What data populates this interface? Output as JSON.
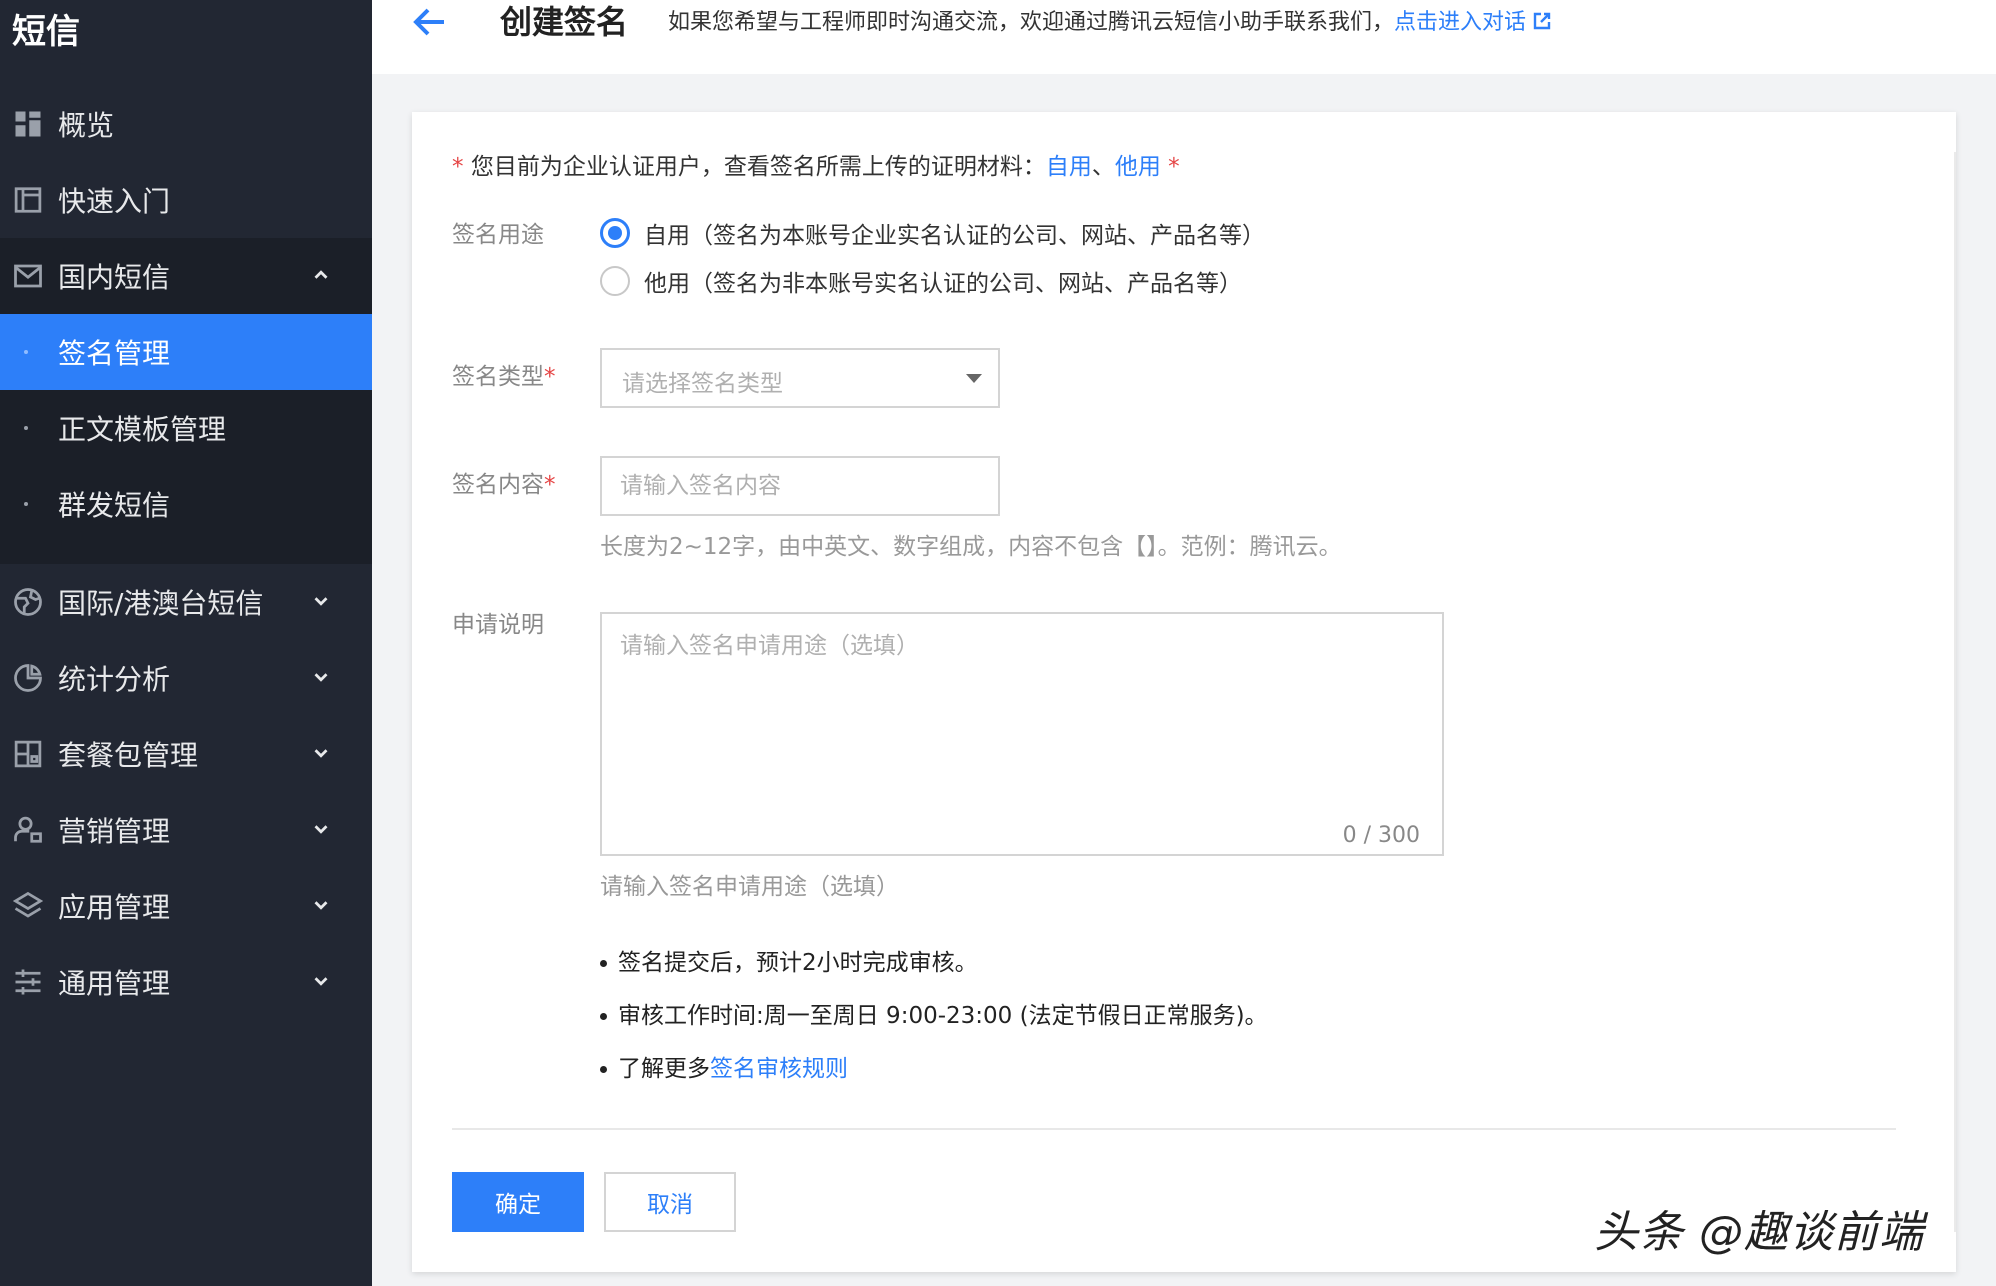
{
  "sidebar": {
    "title": "短信",
    "items": [
      {
        "label": "概览",
        "icon": "dashboard-icon"
      },
      {
        "label": "快速入门",
        "icon": "book-icon"
      },
      {
        "label": "国内短信",
        "icon": "mail-icon",
        "expanded": true,
        "children": [
          {
            "label": "签名管理",
            "active": true
          },
          {
            "label": "正文模板管理"
          },
          {
            "label": "群发短信"
          }
        ]
      },
      {
        "label": "国际/港澳台短信",
        "icon": "globe-icon"
      },
      {
        "label": "统计分析",
        "icon": "pie-chart-icon"
      },
      {
        "label": "套餐包管理",
        "icon": "package-icon"
      },
      {
        "label": "营销管理",
        "icon": "users-icon"
      },
      {
        "label": "应用管理",
        "icon": "layers-icon"
      },
      {
        "label": "通用管理",
        "icon": "sliders-icon"
      }
    ]
  },
  "header": {
    "title": "创建签名",
    "notice_text": "如果您希望与工程师即时沟通交流，欢迎通过腾讯云短信小助手联系我们，",
    "notice_link": "点击进入对话"
  },
  "form": {
    "hint_text": "您目前为企业认证用户，查看签名所需上传的证明材料：",
    "hint_link_self": "自用",
    "hint_sep": "、",
    "hint_link_other": "他用",
    "purpose": {
      "label": "签名用途",
      "options": [
        {
          "label": "自用（签名为本账号企业实名认证的公司、网站、产品名等）",
          "selected": true
        },
        {
          "label": "他用（签名为非本账号实名认证的公司、网站、产品名等）",
          "selected": false
        }
      ]
    },
    "type": {
      "label": "签名类型",
      "placeholder": "请选择签名类型"
    },
    "content": {
      "label": "签名内容",
      "placeholder": "请输入签名内容",
      "help": "长度为2~12字，由中英文、数字组成，内容不包含【】。范例：腾讯云。"
    },
    "description": {
      "label": "申请说明",
      "placeholder": "请输入签名申请用途（选填）",
      "counter": "0 / 300",
      "help": "请输入签名申请用途（选填）"
    },
    "notes": [
      "签名提交后，预计2小时完成审核。",
      "审核工作时间:周一至周日 9:00-23:00 (法定节假日正常服务)。"
    ],
    "note_more_prefix": "了解更多",
    "note_more_link": "签名审核规则",
    "buttons": {
      "confirm": "确定",
      "cancel": "取消"
    }
  },
  "watermark": "头条 @趣谈前端",
  "colors": {
    "accent": "#2d7ff9",
    "sidebar_bg": "#222733",
    "required": "#e54545"
  }
}
